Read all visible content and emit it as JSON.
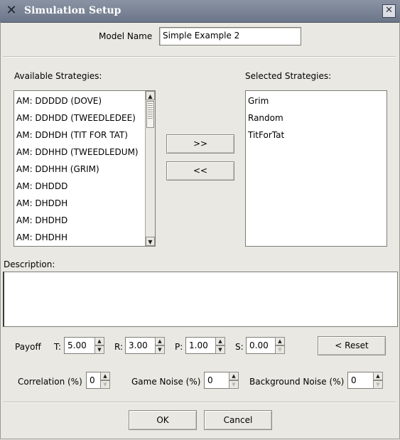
{
  "window": {
    "title": "Simulation Setup",
    "close_glyph": "✕",
    "app_glyph": "✕"
  },
  "model": {
    "label": "Model Name",
    "value": "Simple Example 2"
  },
  "available": {
    "label": "Available Strategies:",
    "items": [
      "AM: DDDDD (DOVE)",
      "AM: DDHDD (TWEEDLEDEE)",
      "AM: DDHDH (TIT FOR TAT)",
      "AM: DDHHD (TWEEDLEDUM)",
      "AM: DDHHH (GRIM)",
      "AM: DHDDD",
      "AM: DHDDH",
      "AM: DHDHD",
      "AM: DHDHH"
    ]
  },
  "selected": {
    "label": "Selected Strategies:",
    "items": [
      "Grim",
      "Random",
      "TitForTat"
    ]
  },
  "transfer": {
    "add_label": ">>",
    "remove_label": "<<"
  },
  "description": {
    "label": "Description:",
    "value": ""
  },
  "payoff": {
    "label": "Payoff",
    "t_label": "T:",
    "t_value": "5.00",
    "r_label": "R:",
    "r_value": "3.00",
    "p_label": "P:",
    "p_value": "1.00",
    "s_label": "S:",
    "s_value": "0.00",
    "reset_label": "< Reset"
  },
  "noise": {
    "correlation_label": "Correlation (%)",
    "correlation_value": "0",
    "game_noise_label": "Game Noise (%)",
    "game_noise_value": "0",
    "background_noise_label": "Background Noise (%)",
    "background_noise_value": "0"
  },
  "actions": {
    "ok_label": "OK",
    "cancel_label": "Cancel"
  },
  "icons": {
    "up_arrow": "▲",
    "down_arrow": "▼"
  },
  "colors": {
    "titlebar": "#7a8396",
    "panel": "#e9e8e2"
  }
}
